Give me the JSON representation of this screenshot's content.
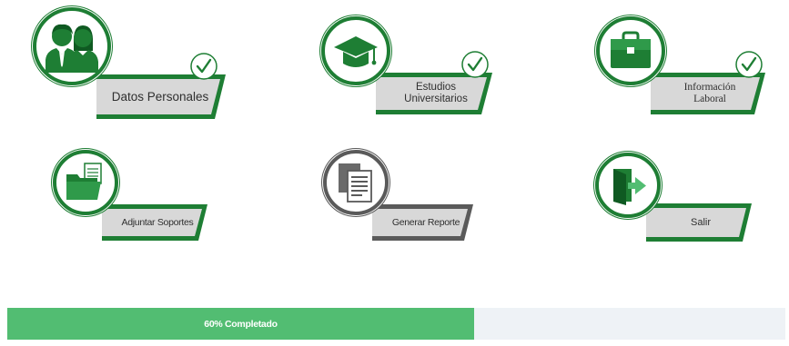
{
  "tiles": [
    {
      "label": "Datos Personales",
      "icon": "users-icon",
      "completed": true
    },
    {
      "label": "Estudios\nUniversitarios",
      "icon": "graduation-cap-icon",
      "completed": true
    },
    {
      "label": "Información\nLaboral",
      "icon": "briefcase-icon",
      "completed": true
    },
    {
      "label": "Adjuntar Soportes",
      "icon": "folder-icon",
      "completed": false
    },
    {
      "label": "Generar Reporte",
      "icon": "document-icon",
      "completed": false
    },
    {
      "label": "Salir",
      "icon": "exit-door-icon",
      "completed": false
    }
  ],
  "progress": {
    "label": "60% Completado",
    "percent": 60
  },
  "colors": {
    "primary_green": "#1e7e34",
    "light_green": "#52bd72",
    "banner_grey": "#d8d8d8",
    "track": "#eef2f6",
    "report_grey": "#5a5a5a"
  }
}
